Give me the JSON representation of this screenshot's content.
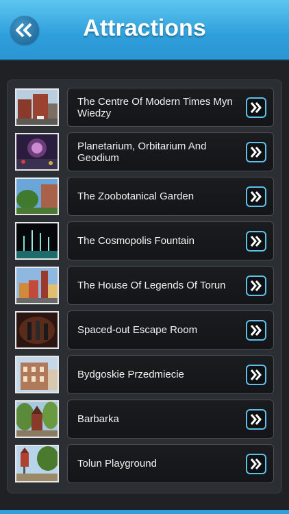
{
  "header": {
    "title": "Attractions",
    "back_icon": "double-chevron-left-icon"
  },
  "accent_color": "#2f9fdc",
  "attractions": [
    {
      "label": "The Centre Of Modern Times Myn Wiedzy",
      "thumb": "thumb-brick-building"
    },
    {
      "label": "Planetarium, Orbitarium And Geodium",
      "thumb": "thumb-planetarium"
    },
    {
      "label": "The Zoobotanical Garden",
      "thumb": "thumb-garden"
    },
    {
      "label": "The Cosmopolis Fountain",
      "thumb": "thumb-fountain-night"
    },
    {
      "label": "The House Of Legends Of Torun",
      "thumb": "thumb-old-town"
    },
    {
      "label": "Spaced-out Escape Room",
      "thumb": "thumb-escape-room"
    },
    {
      "label": "Bydgoskie Przedmiecie",
      "thumb": "thumb-tenement"
    },
    {
      "label": "Barbarka",
      "thumb": "thumb-chapel"
    },
    {
      "label": "Tolun Playground",
      "thumb": "thumb-playground"
    }
  ]
}
